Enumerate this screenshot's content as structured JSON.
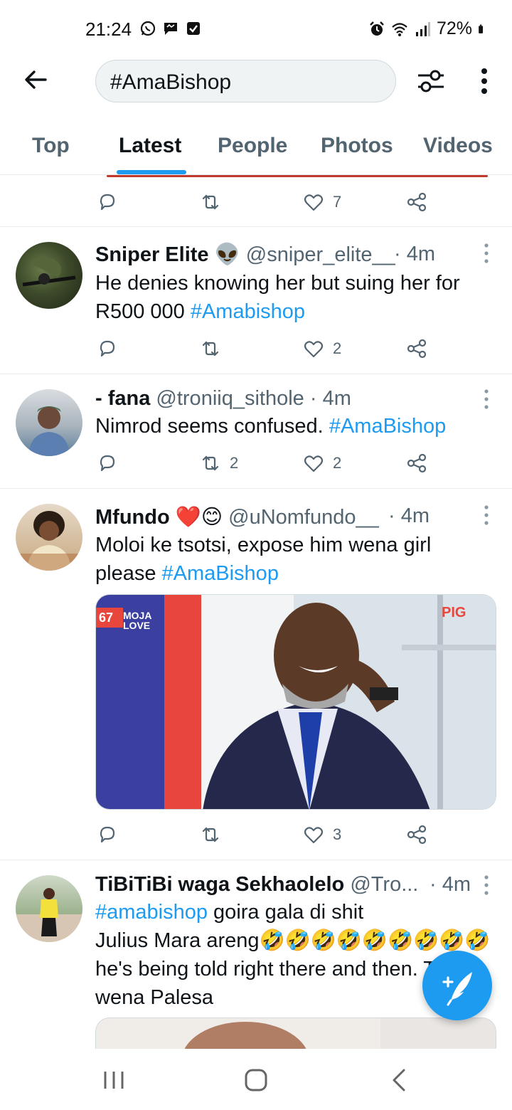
{
  "status_bar": {
    "time": "21:24",
    "battery": "72%",
    "icons_left": [
      "whatsapp-icon",
      "chat-bubble-icon",
      "checkbox-icon"
    ],
    "icons_right": [
      "alarm-icon",
      "wifi-icon",
      "signal-icon",
      "battery-icon"
    ]
  },
  "search": {
    "query": "#AmaBishop"
  },
  "tabs": [
    {
      "label": "Top",
      "active": false
    },
    {
      "label": "Latest",
      "active": true
    },
    {
      "label": "People",
      "active": false
    },
    {
      "label": "Photos",
      "active": false
    },
    {
      "label": "Videos",
      "active": false
    }
  ],
  "prev_tweet_actions": {
    "likes": "7"
  },
  "tweets": [
    {
      "name": "Sniper Elite",
      "emoji": "👽",
      "handle": "@sniper_elite__",
      "time": "· 4m",
      "text": "He denies knowing her but suing her for R500 000 ",
      "hashtag": "#Amabishop",
      "retweets": "",
      "likes": "2"
    },
    {
      "name": "- fana",
      "handle": "@troniiq_sithole",
      "time": "· 4m",
      "text": "Nimrod seems confused. ",
      "hashtag": "#AmaBishop",
      "retweets": "2",
      "likes": "2"
    },
    {
      "name": "Mfundo",
      "emoji": "❤️😊",
      "handle": "@uNomfundo__",
      "time": "· 4m",
      "text": "Moloi ke tsotsi, expose him wena girl please ",
      "hashtag": "#AmaBishop",
      "media_label_1": "MOJA LOVE",
      "media_label_2": "PIG",
      "media_label_3": "67",
      "retweets": "",
      "likes": "3"
    },
    {
      "name": "TiBiTiBi waga Sekhaolelo",
      "handle": "@Tro...",
      "time": "· 4m",
      "hashtag": "#amabishop",
      "text_1": " goira gala di shit",
      "text_2": "Julius Mara areng🤣🤣🤣🤣🤣🤣🤣🤣🤣",
      "text_3": "he's being told right there and then. Tsota",
      "text_4": "wena Palesa"
    }
  ],
  "colors": {
    "accent": "#1d9bf0",
    "text": "#0f1419",
    "muted": "#536471",
    "border": "#e6ecf0"
  }
}
